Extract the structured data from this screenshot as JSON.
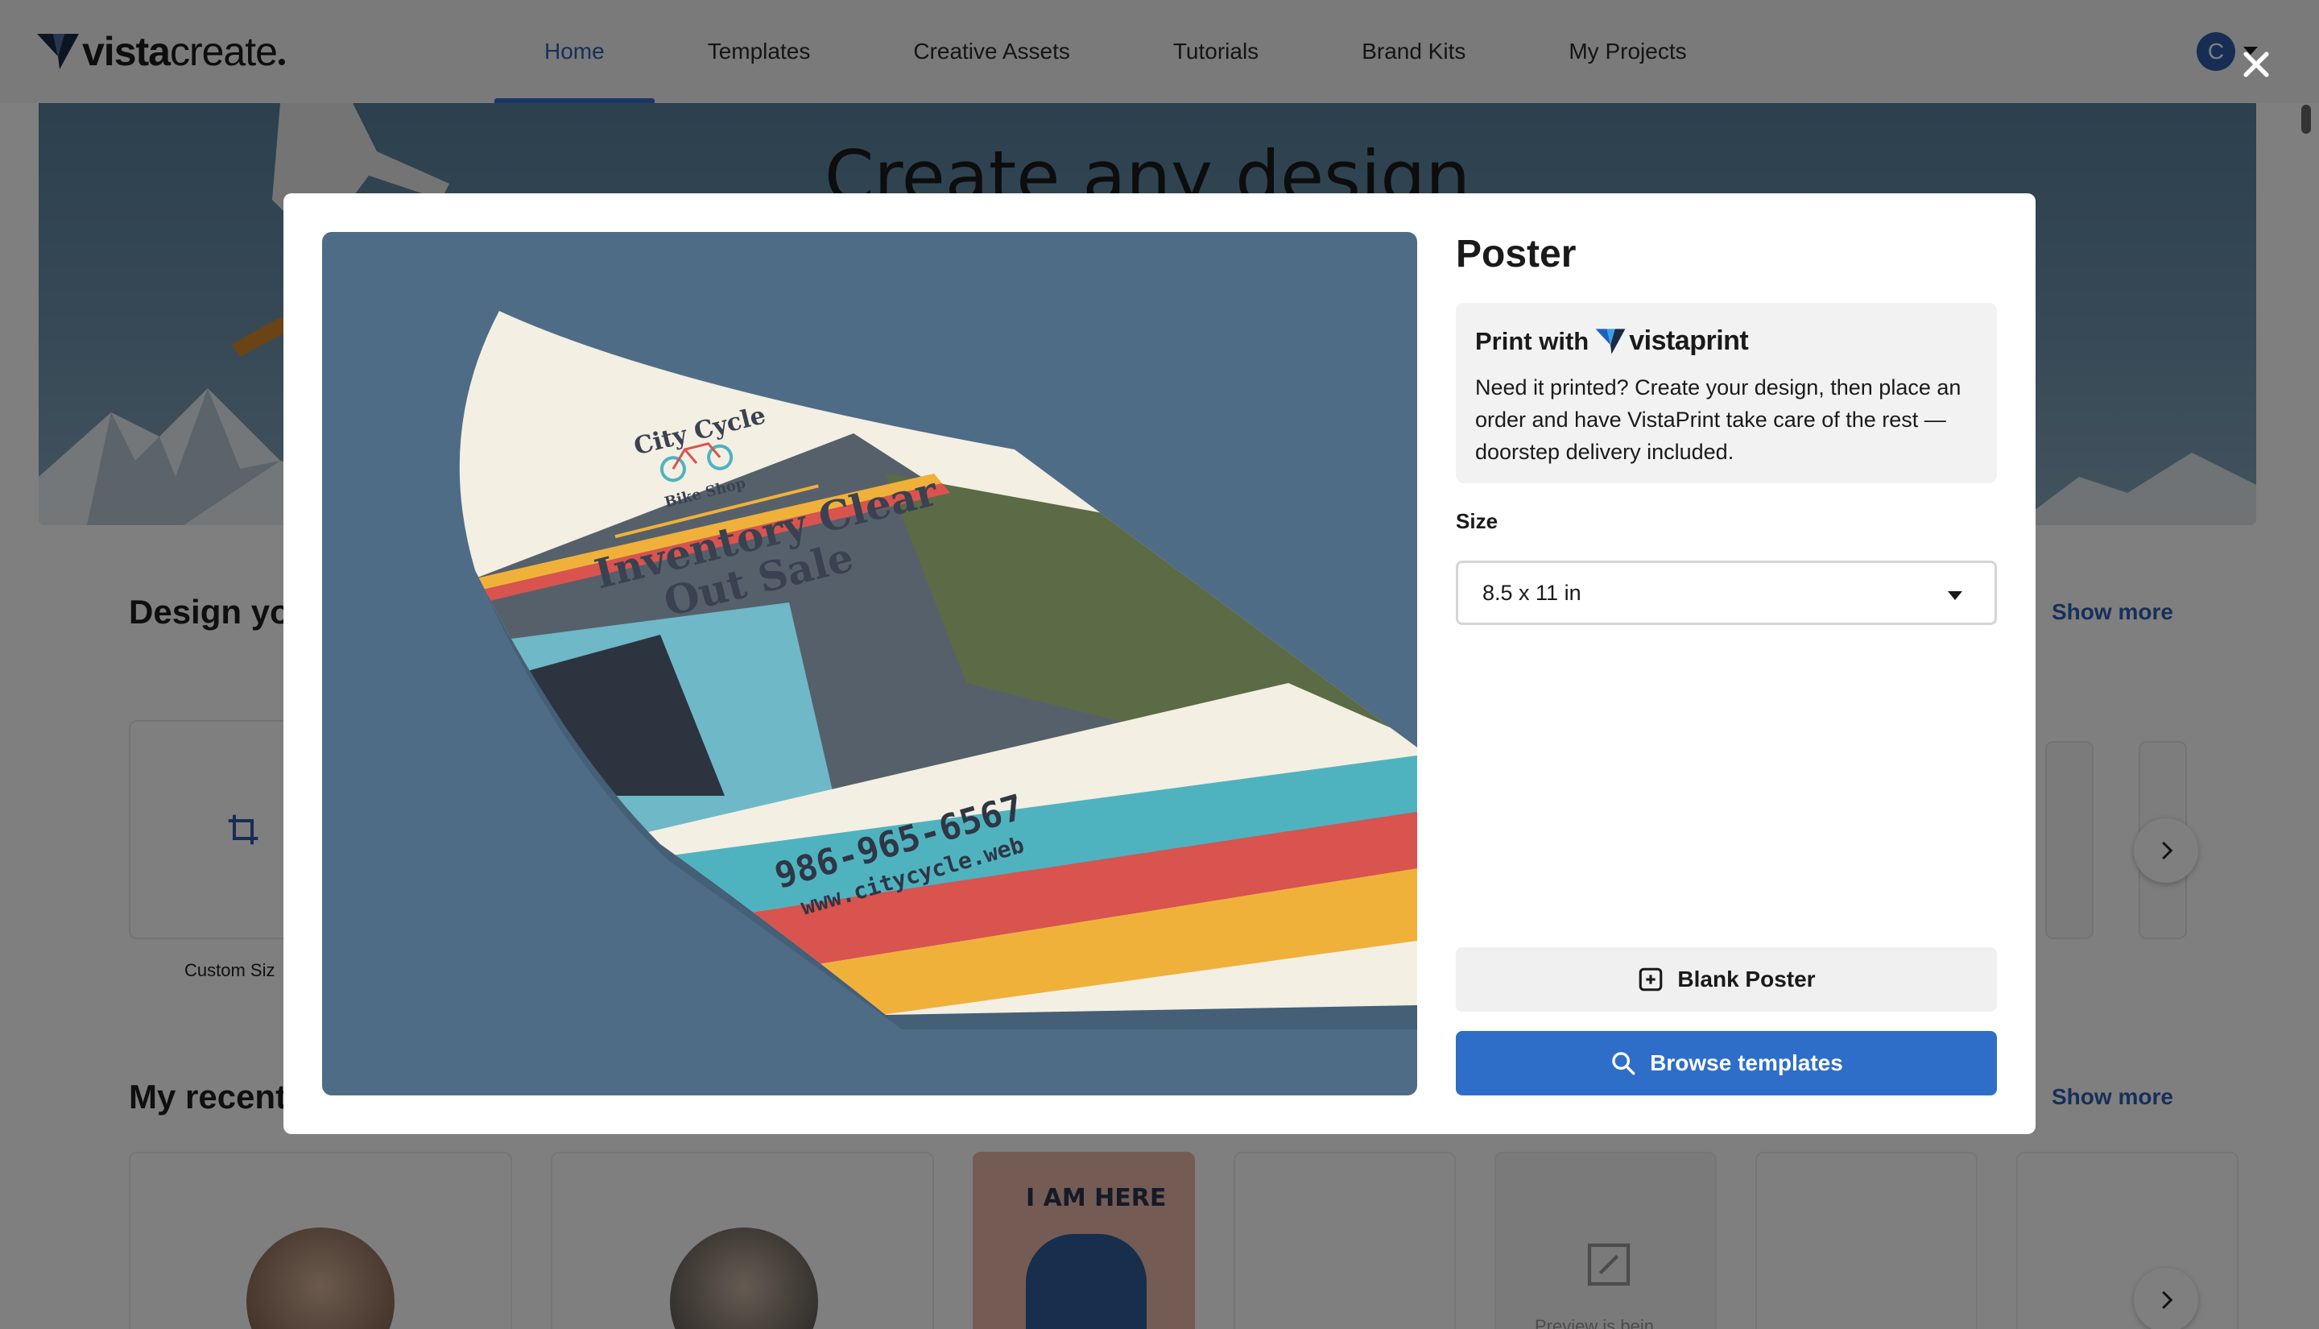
{
  "header": {
    "logo_text_bold": "vista",
    "logo_text_light": "create",
    "nav": [
      {
        "label": "Home",
        "active": true
      },
      {
        "label": "Templates",
        "active": false
      },
      {
        "label": "Creative Assets",
        "active": false
      },
      {
        "label": "Tutorials",
        "active": false
      },
      {
        "label": "Brand Kits",
        "active": false
      },
      {
        "label": "My Projects",
        "active": false
      }
    ],
    "avatar_initial": "C"
  },
  "background_page": {
    "hero_title": "Create any design",
    "design_section_title": "Design you",
    "design_show_more": "Show more",
    "custom_size_label": "Custom Siz",
    "recent_section_title": "My recent d",
    "recent_show_more": "Show more",
    "recent_item_text": "I AM HERE",
    "preview_pending_text": "Preview is bein"
  },
  "modal": {
    "title": "Poster",
    "print_with_label": "Print with",
    "vistaprint_bold": "vista",
    "vistaprint_light": "print",
    "print_description": "Need it printed? Create your design, then place an order and have VistaPrint take care of the rest — doorstep delivery included.",
    "size_label": "Size",
    "size_selected": "8.5 x 11 in",
    "blank_button": "Blank Poster",
    "browse_button": "Browse templates",
    "preview": {
      "shop_name": "City Cycle",
      "shop_subtitle": "Bike Shop",
      "headline_line1": "Inventory Clear",
      "headline_line2": "Out Sale",
      "phone": "986-965-6567",
      "website": "www.citycycle.web"
    }
  },
  "colors": {
    "accent": "#2e6dc8",
    "nav_active": "#2f5fb3",
    "header_bg": "#f4f4f4",
    "stripe_teal": "#4fb3bf",
    "stripe_red": "#d9534f",
    "stripe_yellow": "#f0b13a"
  },
  "icons": {
    "close": "close-icon",
    "dropdown": "chevron-down-icon",
    "blank": "plus-square-icon",
    "search": "search-icon",
    "next": "chevron-right-icon",
    "crop": "crop-icon"
  }
}
